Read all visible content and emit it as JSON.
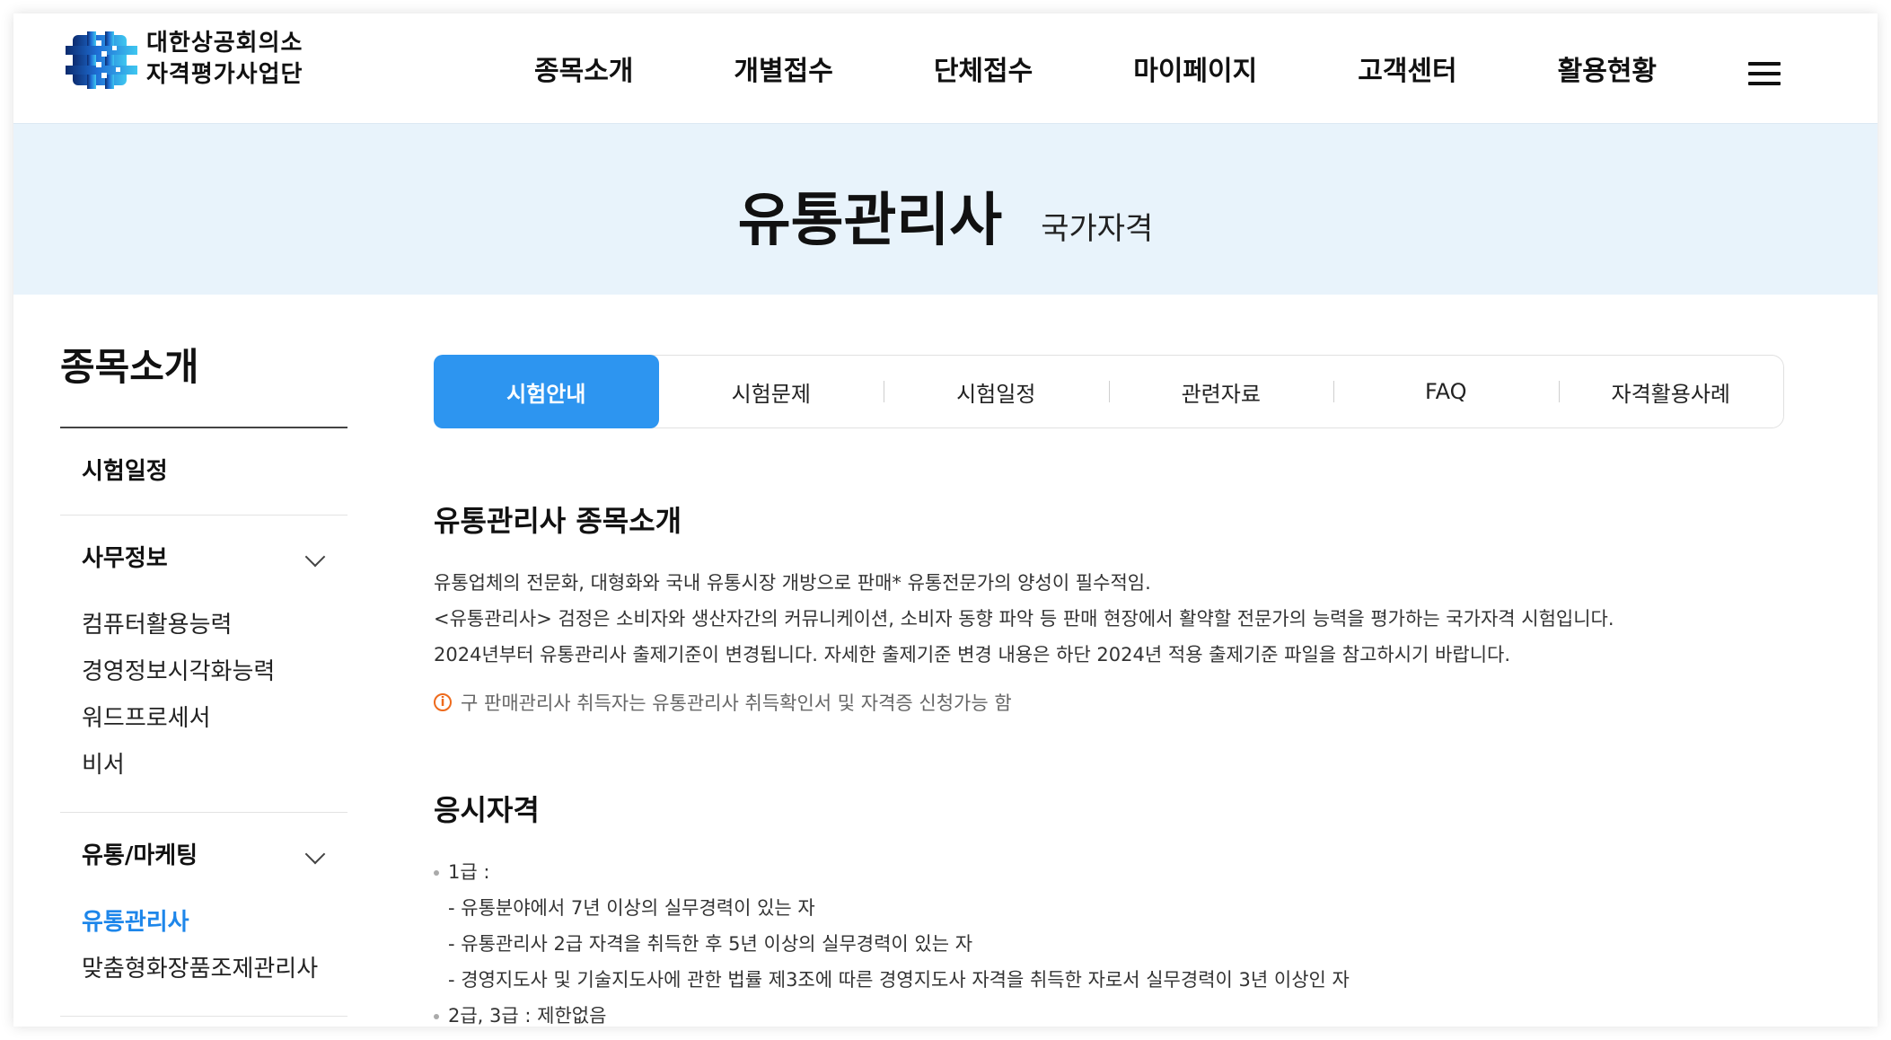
{
  "header": {
    "logo_lines": [
      "대한상공회의소",
      "자격평가사업단"
    ],
    "nav": [
      "종목소개",
      "개별접수",
      "단체접수",
      "마이페이지",
      "고객센터",
      "활용현황"
    ]
  },
  "banner": {
    "title": "유통관리사",
    "subtitle": "국가자격"
  },
  "sidebar": {
    "title": "종목소개",
    "single": "시험일정",
    "groups": [
      {
        "label": "사무정보",
        "items": [
          "컴퓨터활용능력",
          "경영정보시각화능력",
          "워드프로세서",
          "비서"
        ]
      },
      {
        "label": "유통/마케팅",
        "items": [
          "유통관리사",
          "맞춤형화장품조제관리사"
        ],
        "active_item": "유통관리사"
      }
    ]
  },
  "tabs": [
    "시험안내",
    "시험문제",
    "시험일정",
    "관련자료",
    "FAQ",
    "자격활용사례"
  ],
  "active_tab": "시험안내",
  "intro": {
    "title": "유통관리사 종목소개",
    "paragraphs": [
      "유통업체의 전문화, 대형화와 국내 유통시장 개방으로 판매* 유통전문가의 양성이 필수적임.",
      "<유통관리사> 검정은 소비자와 생산자간의 커뮤니케이션, 소비자 동향 파악 등 판매 현장에서 활약할 전문가의 능력을 평가하는 국가자격 시험입니다.",
      "2024년부터 유통관리사 출제기준이 변경됩니다. 자세한 출제기준 변경 내용은 하단 2024년 적용 출제기준 파일을 참고하시기 바랍니다."
    ],
    "notice": "구 판매관리사 취득자는 유통관리사 취득확인서 및 자격증 신청가능 함"
  },
  "eligibility": {
    "title": "응시자격",
    "grade1_label": "1급 :",
    "grade1_items": [
      "- 유통분야에서 7년 이상의 실무경력이 있는 자",
      "- 유통관리사 2급 자격을 취득한 후 5년 이상의 실무경력이 있는 자",
      "- 경영지도사 및 기술지도사에 관한 법률 제3조에 따른 경영지도사 자격을 취득한 자로서 실무경력이 3년 이상인 자"
    ],
    "grade23": "2급, 3급 : 제한없음"
  },
  "colors": {
    "accent": "#2d95f0",
    "banner_bg": "#e8f3fb",
    "active_link": "#1d86ea",
    "notice": "#ee6a1c"
  }
}
